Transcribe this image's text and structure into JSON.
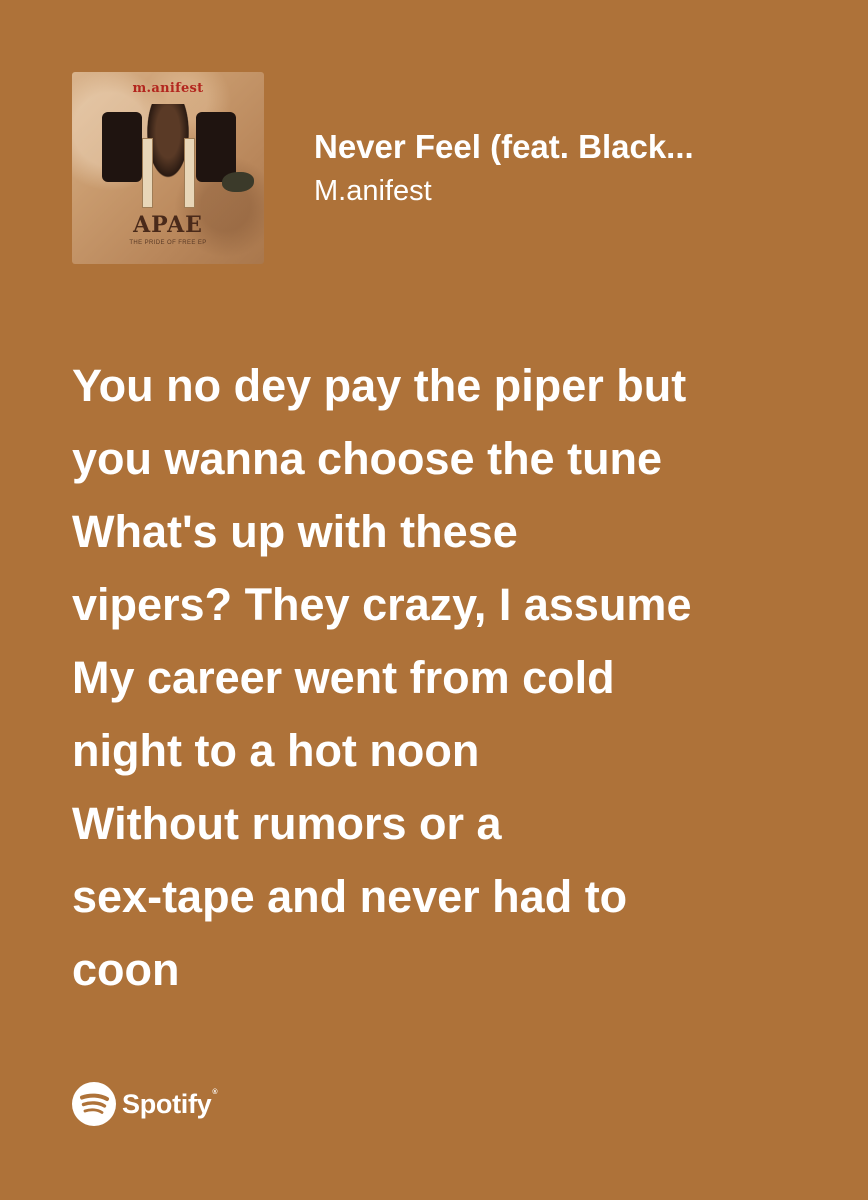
{
  "card": {
    "background_color": "#AE7239",
    "text_color": "#FFFFFF"
  },
  "album_art": {
    "icon": "album-cover-image",
    "brand_text": "m.anifest",
    "title_text": "APAE",
    "subtitle_text": "THE PRIDE OF FREE EP"
  },
  "track": {
    "title": "Never Feel (feat. Black...",
    "artist": "M.anifest"
  },
  "lyrics": [
    "You no dey pay the piper but",
    "you wanna choose the tune",
    "What's up with these",
    "vipers? They crazy, I assume",
    "My career went from cold",
    "night to a hot noon",
    "Without rumors or a",
    "sex-tape and never had to",
    "coon"
  ],
  "footer": {
    "icon": "spotify-logo-icon",
    "wordmark": "Spotify",
    "trademark": "®"
  }
}
